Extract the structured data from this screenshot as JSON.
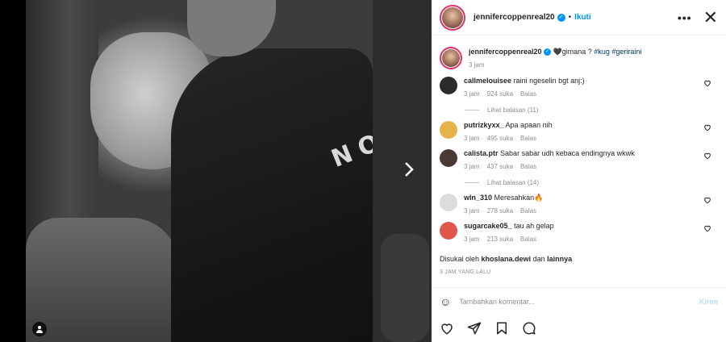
{
  "post": {
    "author": "jennifercoppenreal20",
    "follow_label": "Ikuti",
    "dot": "•",
    "more_label": "•••",
    "close_label": "✕",
    "caption_user": "jennifercoppenreal20",
    "caption_text": "🖤gimana ? ",
    "caption_tags": "#kug #geriraini",
    "caption_time": "3 jam",
    "photo_text": "NO"
  },
  "comments": [
    {
      "user": "callmelouisee",
      "text": "raini ngeselin bgt anj:)",
      "time": "3 jam",
      "likes": "924 suka",
      "reply": "Balas",
      "view_replies": "Lihat balasan (11)",
      "avatar_color": "#2b2b2b"
    },
    {
      "user": "putrizkyxx_",
      "text": "Apa apaan nih",
      "time": "3 jam",
      "likes": "495 suka",
      "reply": "Balas",
      "view_replies": "",
      "avatar_color": "#e6b24a"
    },
    {
      "user": "calista.ptr",
      "text": "Sabar sabar udh kebaca endingnya wkwk",
      "time": "3 jam",
      "likes": "437 suka",
      "reply": "Balas",
      "view_replies": "Lihat balasan (14)",
      "avatar_color": "#4a3a36"
    },
    {
      "user": "wln_310",
      "text": "Meresahkan🔥",
      "time": "3 jam",
      "likes": "278 suka",
      "reply": "Balas",
      "view_replies": "",
      "avatar_color": "#dcdcdc"
    },
    {
      "user": "sugarcake05_",
      "text": "tau ah gelap",
      "time": "3 jam",
      "likes": "213 suka",
      "reply": "Balas",
      "view_replies": "",
      "avatar_color": "#e0564a"
    }
  ],
  "likes_line": {
    "prefix": "Disukai oleh ",
    "user": "khoslana.dewi",
    "middle": " dan ",
    "others": "lainnya"
  },
  "time_ago": "3 JAM YANG LALU",
  "compose": {
    "placeholder": "Tambahkan komentar...",
    "send_label": "Kirim",
    "emoji_icon": "☺"
  },
  "colors": {
    "accent": "#0095f6",
    "send_disabled": "#b2dffc"
  }
}
